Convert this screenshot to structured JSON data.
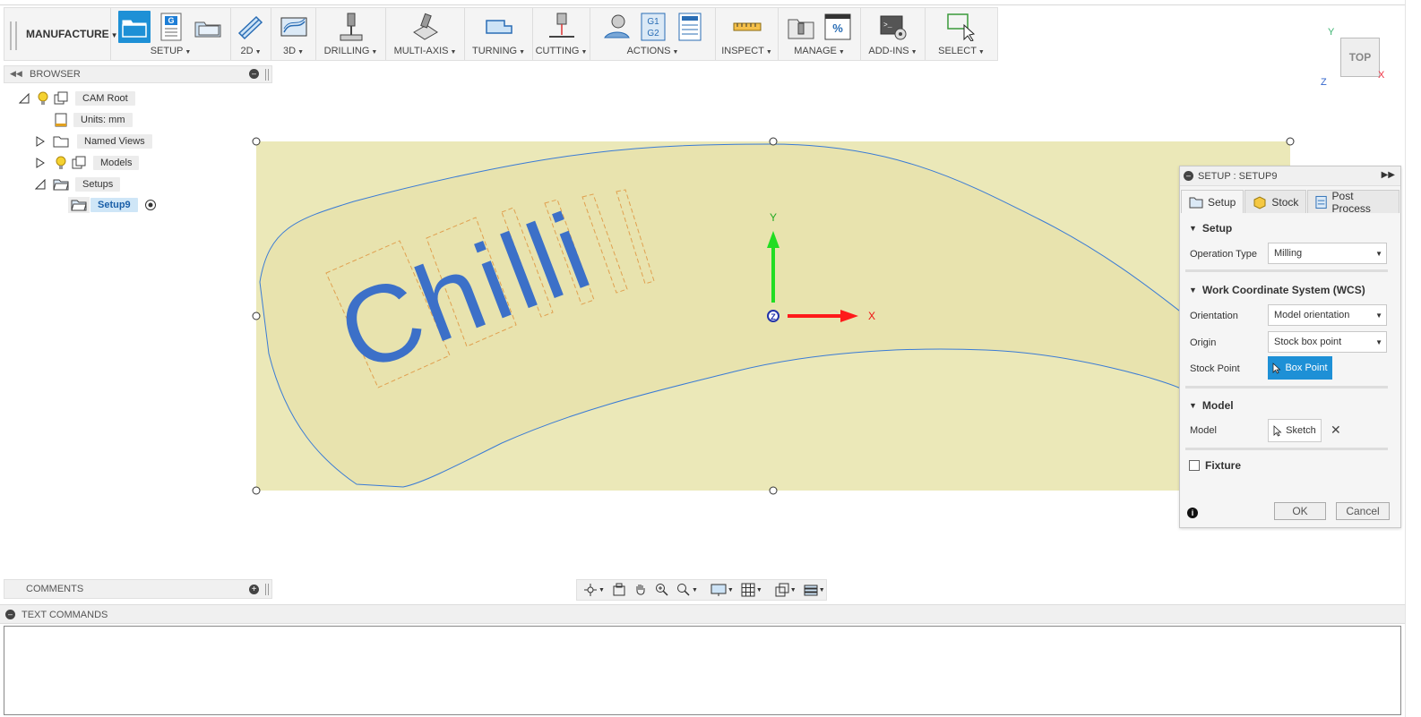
{
  "toolbar": {
    "workspace": "MANUFACTURE",
    "groups": [
      {
        "id": "setup",
        "label": "SETUP"
      },
      {
        "id": "2d",
        "label": "2D"
      },
      {
        "id": "3d",
        "label": "3D"
      },
      {
        "id": "drilling",
        "label": "DRILLING"
      },
      {
        "id": "multiaxis",
        "label": "MULTI-AXIS"
      },
      {
        "id": "turning",
        "label": "TURNING"
      },
      {
        "id": "cutting",
        "label": "CUTTING"
      },
      {
        "id": "actions",
        "label": "ACTIONS"
      },
      {
        "id": "inspect",
        "label": "INSPECT"
      },
      {
        "id": "manage",
        "label": "MANAGE"
      },
      {
        "id": "addins",
        "label": "ADD-INS"
      },
      {
        "id": "select",
        "label": "SELECT"
      }
    ],
    "actions_g1g2": [
      "G1",
      "G2"
    ],
    "setup_g_icon": "G",
    "manage_percent_icon": "%"
  },
  "viewcube": {
    "face": "TOP",
    "x": "X",
    "y": "Y",
    "z": "Z"
  },
  "browser": {
    "title": "BROWSER",
    "items": [
      {
        "label": "CAM Root"
      },
      {
        "label": "Units: mm"
      },
      {
        "label": "Named Views"
      },
      {
        "label": "Models"
      },
      {
        "label": "Setups"
      },
      {
        "label": "Setup9"
      }
    ]
  },
  "canvas": {
    "text": "Chilli",
    "axis_x": "X",
    "axis_y": "Y",
    "axis_z": "Z"
  },
  "setup_panel": {
    "title": "SETUP : SETUP9",
    "tabs": [
      {
        "label": "Setup",
        "icon": "setup-tab-icon"
      },
      {
        "label": "Stock",
        "icon": "stock-cube-icon"
      },
      {
        "label": "Post Process",
        "icon": "post-process-icon"
      }
    ],
    "sections": {
      "setup": "Setup",
      "wcs": "Work Coordinate System (WCS)",
      "model": "Model",
      "fixture": "Fixture"
    },
    "fields": {
      "operation_type_label": "Operation Type",
      "operation_type_value": "Milling",
      "orientation_label": "Orientation",
      "orientation_value": "Model orientation",
      "origin_label": "Origin",
      "origin_value": "Stock box point",
      "stock_point_label": "Stock Point",
      "stock_point_value": "Box Point",
      "model_label": "Model",
      "model_value": "Sketch"
    },
    "fixture_checked": false,
    "ok": "OK",
    "cancel": "Cancel"
  },
  "comments": {
    "title": "COMMENTS"
  },
  "text_commands": {
    "title": "TEXT COMMANDS"
  },
  "colors": {
    "accent": "#1e90d6",
    "stock": "#ebe8b8",
    "letters": "#3c70c8",
    "outline": "#3a7bd5",
    "x_axis": "#ff1a1a",
    "y_axis": "#22dd22"
  }
}
